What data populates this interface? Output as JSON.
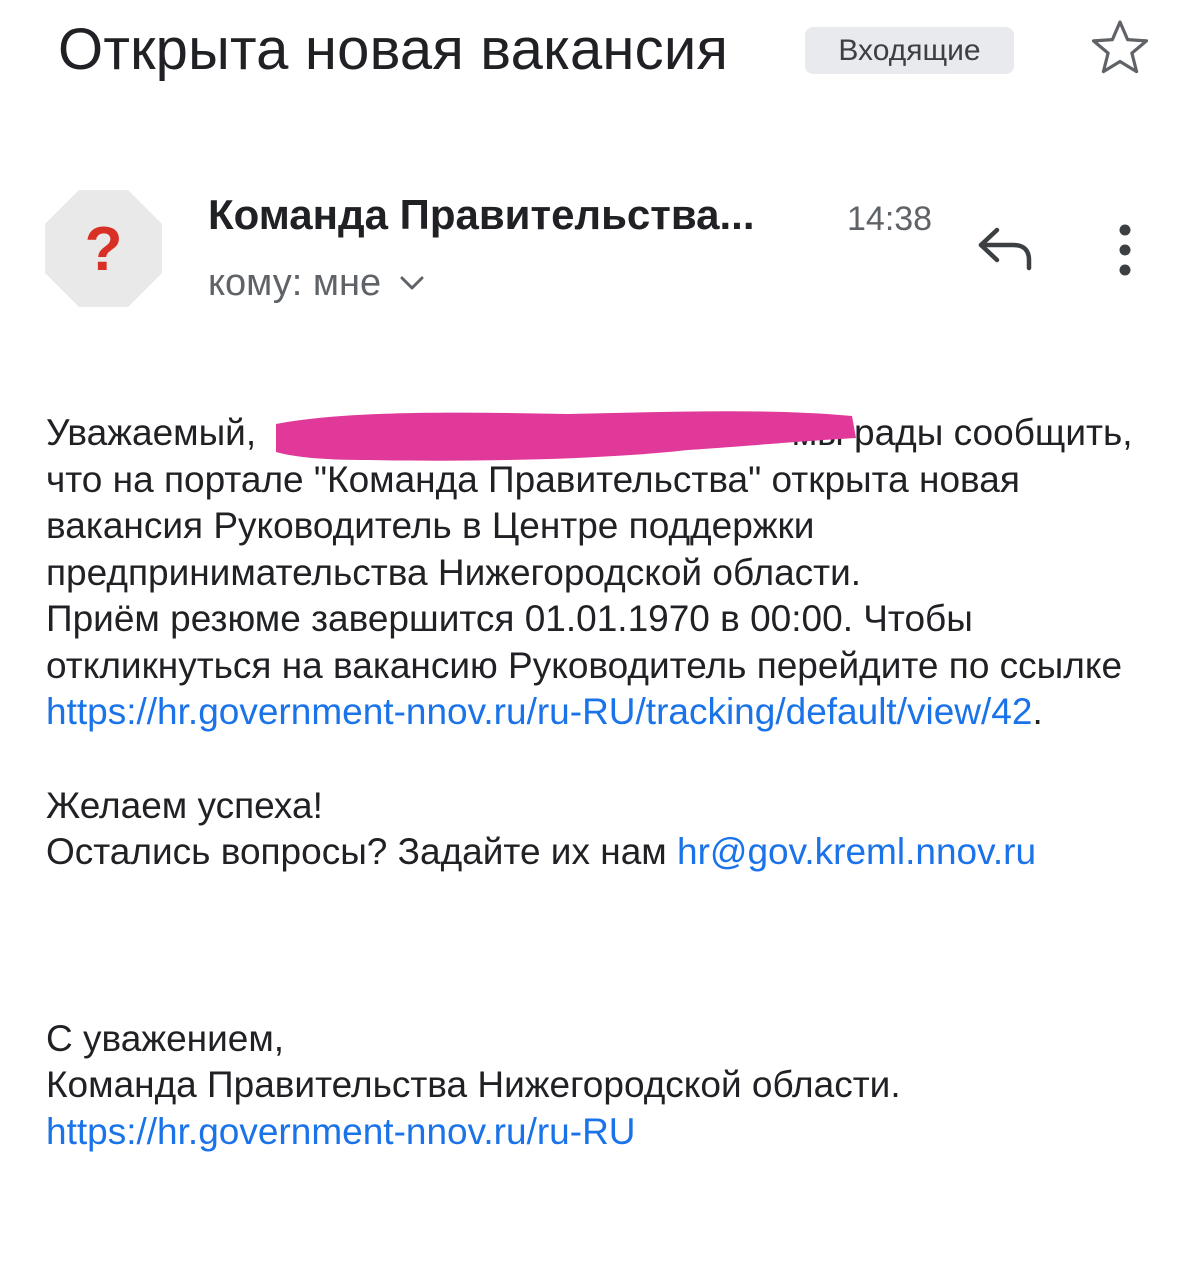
{
  "header": {
    "subject": "Открыта новая вакансия",
    "label": "Входящие",
    "star_icon": "star-outline-icon"
  },
  "message": {
    "avatar_icon": "unknown-sender-icon",
    "avatar_glyph": "?",
    "sender": "Команда Правительства...",
    "time": "14:38",
    "recipient": "кому: мне",
    "reply_icon": "reply-icon",
    "more_icon": "more-vert-icon"
  },
  "body": {
    "greeting_start": "Уважаемый,",
    "greeting_end": "мы рады сообщить, что на портале \"Команда Правительства\" открыта новая вакансия Руководитель в Центре поддержки предпринимательства Нижегородской области.",
    "deadline_text": "Приём резюме завершится 01.01.1970 в 00:00. Чтобы откликнуться на вакансию Руководитель перейдите по ссылке ",
    "vacancy_link": "https://hr.government-nnov.ru/ru-RU/tracking/default/view/42",
    "period": ".",
    "wish": "Желаем успеха!",
    "questions_text": "Остались вопросы? Задайте их нам ",
    "contact_email": "hr@gov.kreml.nnov.ru",
    "regards": "С уважением,",
    "signature": "Команда Правительства Нижегородской области.",
    "portal_link": "https://hr.government-nnov.ru/ru-RU"
  },
  "colors": {
    "link": "#1a73e8",
    "redaction": "#e0399a",
    "avatar_bg": "#e9e9e9",
    "avatar_glyph": "#d93025"
  }
}
